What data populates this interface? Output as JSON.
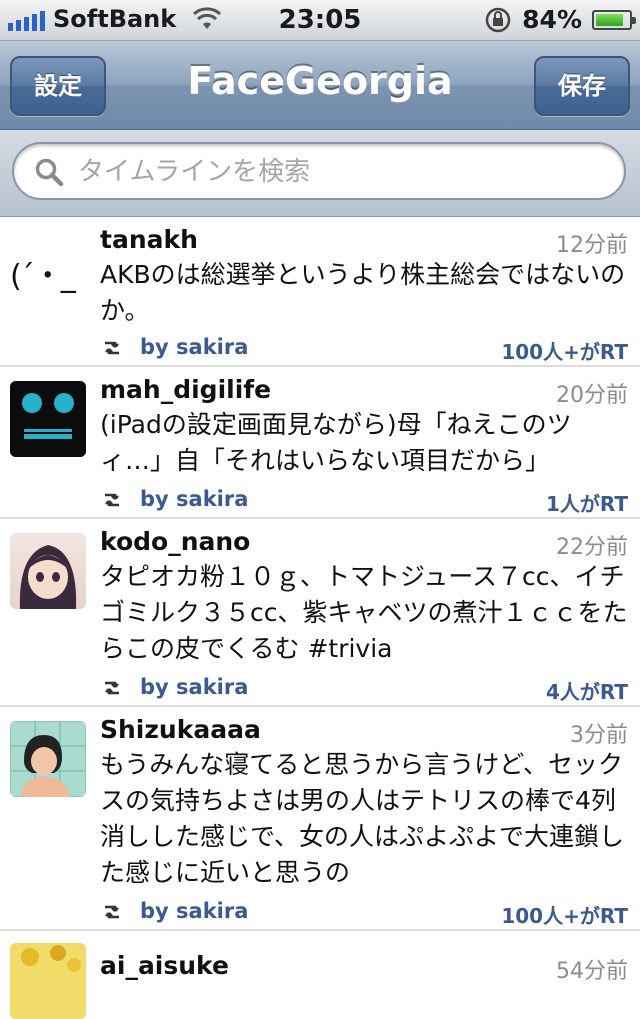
{
  "status": {
    "carrier": "SoftBank",
    "time": "23:05",
    "battery_percent": "84%",
    "battery_level": 0.84
  },
  "nav": {
    "left_button": "設定",
    "title": "FaceGeorgia",
    "right_button": "保存"
  },
  "search": {
    "placeholder": "タイムラインを検索"
  },
  "tweets": [
    {
      "user": "tanakh",
      "ago": "12分前",
      "text": "AKBのは総選挙というより株主総会ではないのか。",
      "by": "by sakira",
      "rt": "100人+がRT",
      "avatar_text": "(´・_"
    },
    {
      "user": "mah_digilife",
      "ago": "20分前",
      "text": "(iPadの設定画面見ながら)母「ねえこのツィ…」自「それはいらない項目だから」",
      "by": "by sakira",
      "rt": "1人がRT"
    },
    {
      "user": "kodo_nano",
      "ago": "22分前",
      "text": "タピオカ粉１０ｇ、トマトジュース７cc、イチゴミルク３５cc、紫キャベツの煮汁１ｃｃをたらこの皮でくるむ #trivia",
      "by": "by sakira",
      "rt": "4人がRT"
    },
    {
      "user": "Shizukaaaa",
      "ago": "3分前",
      "text": "もうみんな寝てると思うから言うけど、セックスの気持ちよさは男の人はテトリスの棒で4列消しした感じで、女の人はぷよぷよで大連鎖した感じに近いと思うの",
      "by": "by sakira",
      "rt": "100人+がRT"
    },
    {
      "user": "ai_aisuke",
      "ago": "54分前"
    }
  ]
}
